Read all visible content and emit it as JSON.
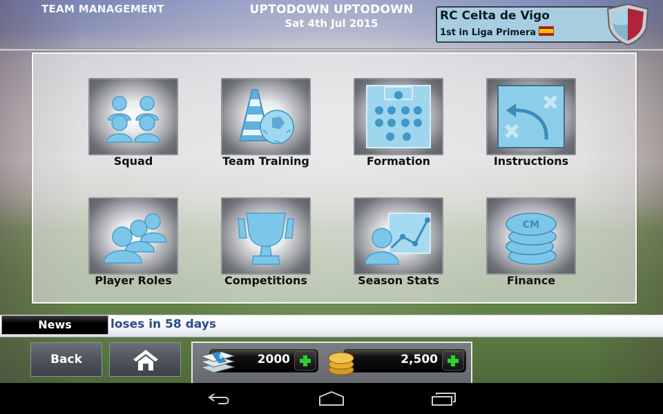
{
  "header": {
    "section_title": "TEAM MANAGEMENT",
    "manager_name": "UPTODOWN UPTODOWN",
    "date": "Sat 4th Jul 2015"
  },
  "club": {
    "name": "RC Celta de Vigo",
    "standing": "1st in Liga Primera",
    "flag_icon": "spain-flag-icon",
    "crest_colors": {
      "left": "#a9d2e6",
      "right": "#b0243a"
    }
  },
  "menu": {
    "items": [
      {
        "label": "Squad",
        "icon": "squad-icon"
      },
      {
        "label": "Team Training",
        "icon": "training-cone-ball-icon"
      },
      {
        "label": "Formation",
        "icon": "formation-pitch-icon"
      },
      {
        "label": "Instructions",
        "icon": "tactics-arrow-icon"
      },
      {
        "label": "Player Roles",
        "icon": "player-roles-icon"
      },
      {
        "label": "Competitions",
        "icon": "trophy-icon"
      },
      {
        "label": "Season Stats",
        "icon": "stats-chart-icon"
      },
      {
        "label": "Finance",
        "icon": "coin-stack-icon"
      }
    ]
  },
  "news": {
    "tab_label": "News",
    "ticker_text": "loses in 58 days"
  },
  "footer": {
    "back_label": "Back",
    "home_icon": "home-icon",
    "cash_value": "2000",
    "coins_value": "2,500",
    "coin_stack_label": "CM"
  },
  "android_nav": {
    "back": "back-icon",
    "home": "home-outline-icon",
    "recents": "recents-icon"
  },
  "colors": {
    "accent_blue": "#6cc0e8",
    "news_text": "#2a4a82",
    "plus_green": "#2fd12a"
  }
}
